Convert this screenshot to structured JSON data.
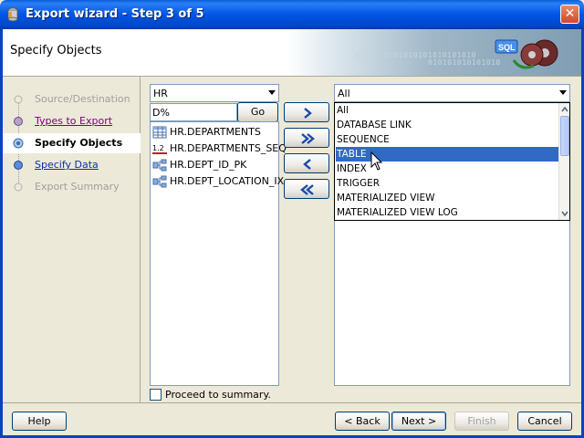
{
  "window": {
    "title": "Export wizard - Step 3 of 5",
    "close_icon": "close-icon"
  },
  "header": {
    "title": "Specify Objects",
    "art_binary_1": "0101010101010101010101010",
    "art_binary_2": "010101010101010",
    "art_sql": "SQL"
  },
  "nav": {
    "steps": [
      {
        "label": "Source/Destination",
        "state": "disabled"
      },
      {
        "label": "Types to Export",
        "state": "visited"
      },
      {
        "label": "Specify Objects",
        "state": "current"
      },
      {
        "label": "Specify Data",
        "state": "link"
      },
      {
        "label": "Export Summary",
        "state": "disabled"
      }
    ]
  },
  "schema": {
    "selected": "HR",
    "filter_value": "D%",
    "go_label": "Go"
  },
  "available_objects": [
    {
      "name": "HR.DEPARTMENTS",
      "icon": "table-icon"
    },
    {
      "name": "HR.DEPARTMENTS_SEQ",
      "icon": "sequence-icon"
    },
    {
      "name": "HR.DEPT_ID_PK",
      "icon": "index-icon"
    },
    {
      "name": "HR.DEPT_LOCATION_IX",
      "icon": "index-icon"
    }
  ],
  "transfer_buttons": [
    "move-right-icon",
    "move-all-right-icon",
    "move-left-icon",
    "move-all-left-icon"
  ],
  "type_filter": {
    "selected": "All",
    "options": [
      "All",
      "DATABASE LINK",
      "SEQUENCE",
      "TABLE",
      "INDEX",
      "TRIGGER",
      "MATERIALIZED VIEW",
      "MATERIALIZED VIEW LOG"
    ],
    "highlighted": "TABLE"
  },
  "proceed_label": "Proceed to summary.",
  "footer": {
    "help": "Help",
    "back": "< Back",
    "next": "Next >",
    "finish": "Finish",
    "cancel": "Cancel"
  },
  "colors": {
    "titlebar": "#0055e5",
    "selection": "#316ac5",
    "dialog_bg": "#ece9d8"
  }
}
